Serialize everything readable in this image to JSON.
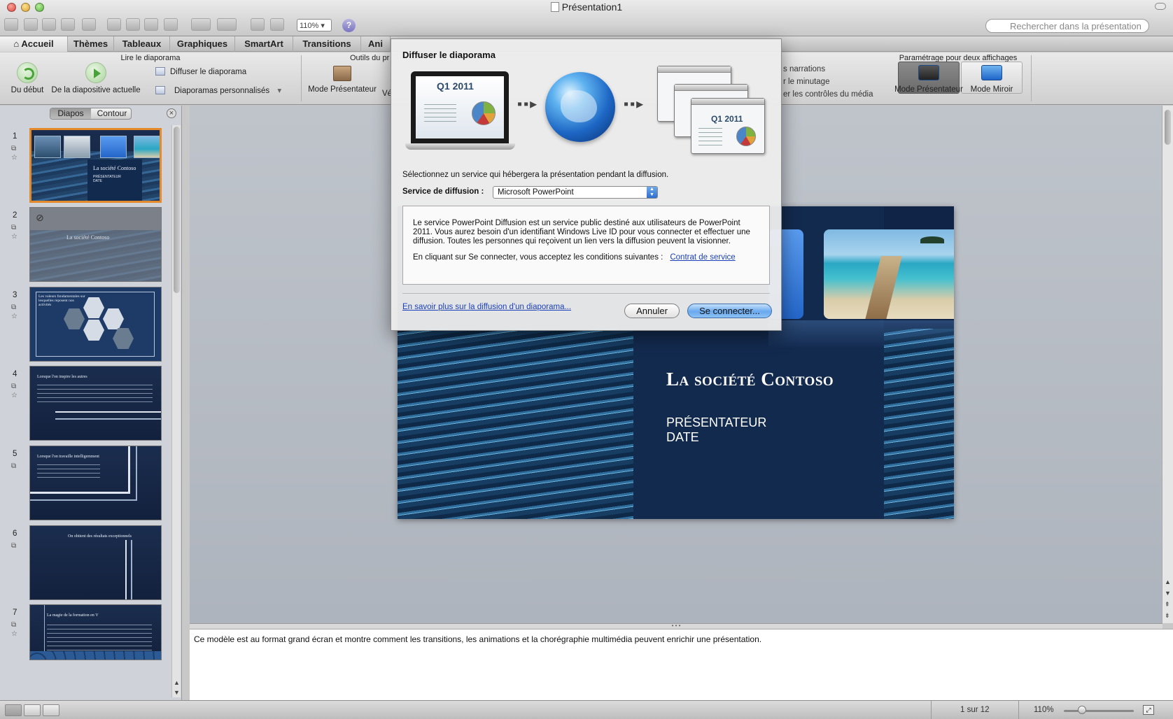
{
  "window": {
    "title": "Présentation1",
    "zoom": "110%",
    "search_placeholder": "Rechercher dans la présentation"
  },
  "ribbon": {
    "tabs": [
      "Accueil",
      "Thèmes",
      "Tableaux",
      "Graphiques",
      "SmartArt",
      "Transitions",
      "Ani"
    ],
    "groups": {
      "play": "Lire le diaporama",
      "presenter_tools": "Outils du pr",
      "dual": "Paramétrage pour deux affichages"
    },
    "buttons": {
      "from_start": "Du début",
      "from_current": "De la diapositive actuelle",
      "broadcast": "Diffuser le diaporama",
      "custom_shows": "Diaporamas personnalisés",
      "presenter_mode": "Mode Présentateur",
      "presenter_mode_cut": "Vé",
      "narrations": "s narrations",
      "timing": "r le minutage",
      "media_controls": "er les contrôles du média",
      "dual_presenter": "Mode Présentateur",
      "dual_mirror": "Mode Miroir"
    }
  },
  "leftpane": {
    "tab_slides": "Diapos",
    "tab_outline": "Contour",
    "slides": [
      {
        "num": "1",
        "title": "La société Contoso",
        "sub": "PRÉSENTATEUR\nDATE"
      },
      {
        "num": "2",
        "title": "La société Contoso",
        "sub": ""
      },
      {
        "num": "3",
        "title": "Les valeurs fondamentales sur lesquelles reposent nos activités",
        "sub": ""
      },
      {
        "num": "4",
        "title": "Lorsque l'on inspire les autres",
        "sub": ""
      },
      {
        "num": "5",
        "title": "Lorsque l'on travaille intelligemment",
        "sub": ""
      },
      {
        "num": "6",
        "title": "On obtient des résultats exceptionnels",
        "sub": ""
      },
      {
        "num": "7",
        "title": "La magie de la formation en V",
        "sub": ""
      }
    ]
  },
  "slide": {
    "title": "La société Contoso",
    "subtitle": "PRÉSENTATEUR\nDATE"
  },
  "notes": "Ce modèle est au format grand écran et montre comment les transitions, les animations et la chorégraphie multimédia peuvent enrichir une présentation.",
  "statusbar": {
    "slide_counter": "1 sur 12",
    "zoom": "110%"
  },
  "dialog": {
    "title": "Diffuser le diaporama",
    "illustration_label": "Q1 2011",
    "select_service_text": "Sélectionnez un service qui hébergera la présentation pendant la diffusion.",
    "service_label": "Service de diffusion :",
    "service_value": "Microsoft PowerPoint",
    "info_p1": "Le service PowerPoint Diffusion est un service public destiné aux utilisateurs de PowerPoint 2011. Vous aurez besoin d'un identifiant Windows Live ID pour vous connecter et effectuer une diffusion. Toutes les personnes qui reçoivent un lien vers la diffusion peuvent la visionner.",
    "info_p2": "En cliquant sur Se connecter, vous acceptez les conditions suivantes :",
    "contract_link": "Contrat de service",
    "learn_more": "En savoir plus sur la diffusion d'un diaporama...",
    "cancel": "Annuler",
    "connect": "Se connecter..."
  },
  "colors": {
    "accent_blue": "#2d6fd0",
    "selection_orange": "#e48a2a",
    "slide_navy": "#132a4f"
  }
}
